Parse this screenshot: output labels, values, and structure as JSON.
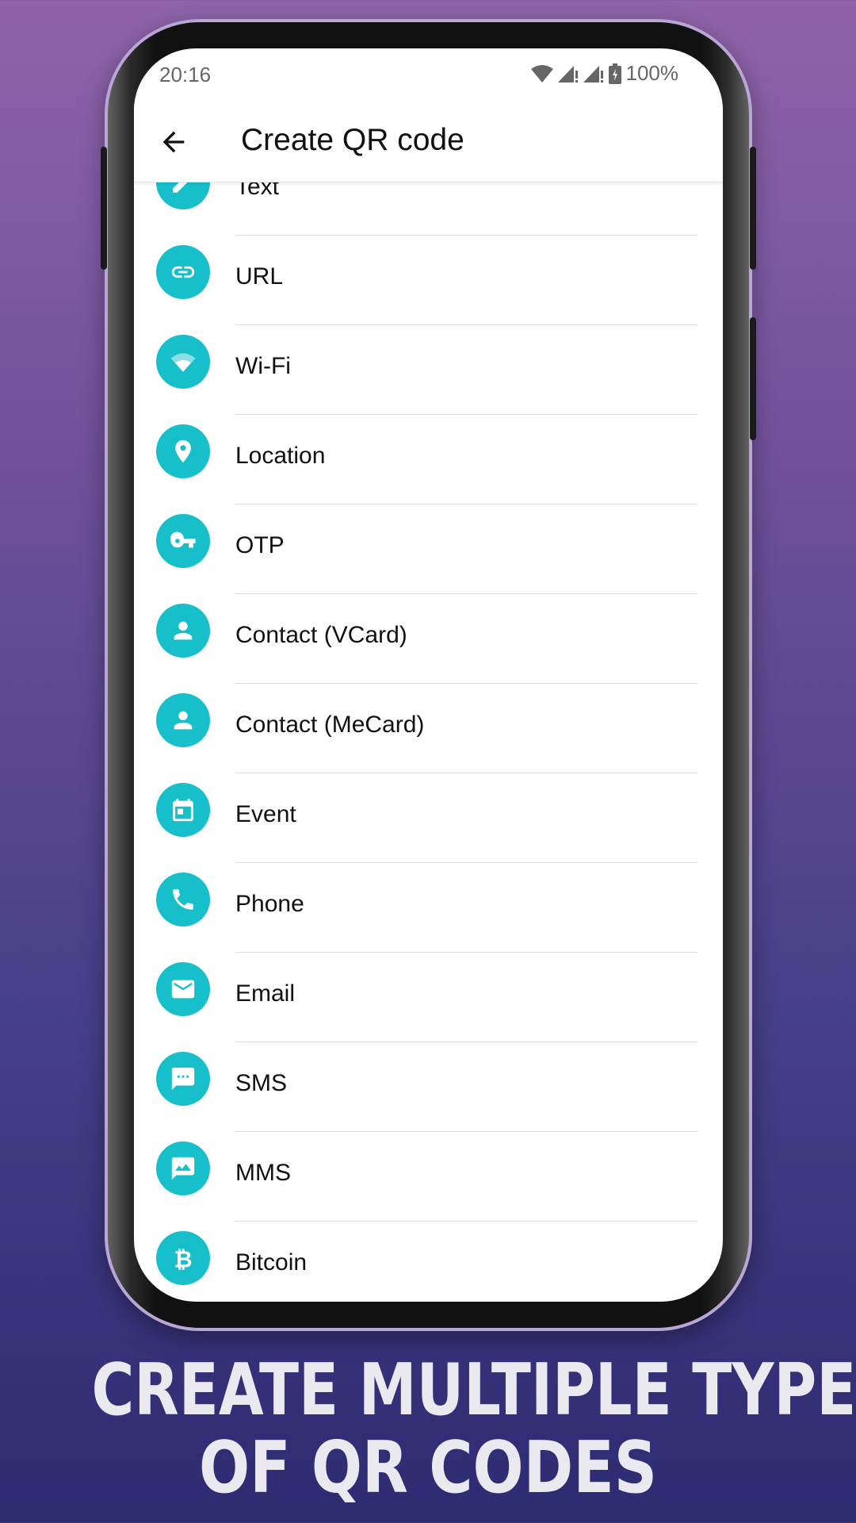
{
  "status_bar": {
    "time": "20:16",
    "battery": "100%",
    "icons": [
      "wifi-icon",
      "signal-icon",
      "signal-icon",
      "battery-charging-icon"
    ]
  },
  "toolbar": {
    "title": "Create QR code",
    "back_icon": "arrow-back-icon"
  },
  "items": [
    {
      "label": "Text",
      "icon": "pencil-icon"
    },
    {
      "label": "URL",
      "icon": "link-icon"
    },
    {
      "label": "Wi-Fi",
      "icon": "wifi-icon"
    },
    {
      "label": "Location",
      "icon": "location-pin-icon"
    },
    {
      "label": "OTP",
      "icon": "key-icon"
    },
    {
      "label": "Contact (VCard)",
      "icon": "person-icon"
    },
    {
      "label": "Contact (MeCard)",
      "icon": "person-icon"
    },
    {
      "label": "Event",
      "icon": "calendar-icon"
    },
    {
      "label": "Phone",
      "icon": "phone-icon"
    },
    {
      "label": "Email",
      "icon": "email-icon"
    },
    {
      "label": "SMS",
      "icon": "sms-icon"
    },
    {
      "label": "MMS",
      "icon": "mms-icon"
    },
    {
      "label": "Bitcoin",
      "icon": "bitcoin-icon"
    }
  ],
  "caption": {
    "line1": "CREATE MULTIPLE TYPES",
    "line2": "OF QR CODES"
  },
  "colors": {
    "accent": "#16bfc9",
    "bg_top": "#8f63a9",
    "bg_bottom": "#2d2b72",
    "caption": "#e9e9ef"
  }
}
